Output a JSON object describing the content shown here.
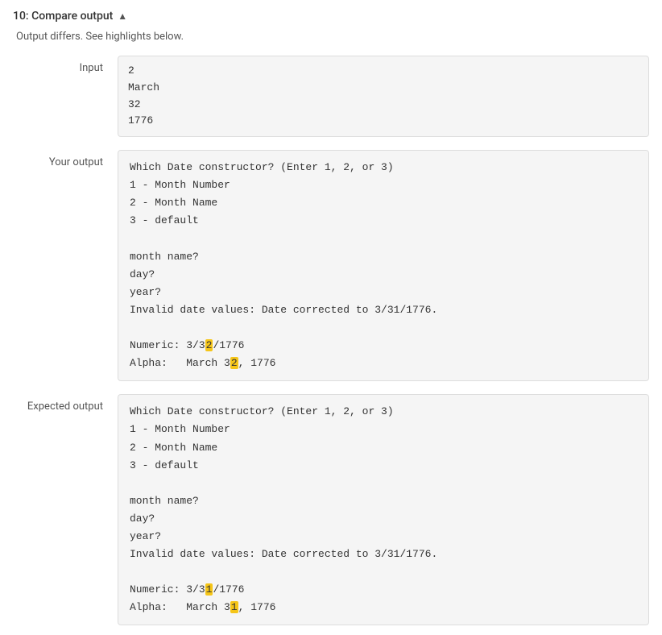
{
  "header": {
    "title": "10: Compare output",
    "chevron": "▲"
  },
  "diff_notice": "Output differs. See highlights below.",
  "input": {
    "label": "Input",
    "lines": [
      "2",
      "March",
      "32",
      "1776"
    ]
  },
  "your_output": {
    "label": "Your output",
    "line1": "Which Date constructor? (Enter 1, 2, or 3)",
    "line2": "1 - Month Number",
    "line3": "2 - Month Name",
    "line4": "3 - default",
    "line5": "",
    "line6": "month name?",
    "line7": "day?",
    "line8": "year?",
    "line9_prefix": "Invalid date values: Date corrected to 3/31/1776.",
    "line10": "",
    "line11_prefix": "Numeric: 3/3",
    "line11_highlight": "2",
    "line11_suffix": "/1776",
    "line12_prefix": "Alpha:   March 3",
    "line12_highlight": "2",
    "line12_suffix": ", 1776"
  },
  "expected_output": {
    "label": "Expected output",
    "line1": "Which Date constructor? (Enter 1, 2, or 3)",
    "line2": "1 - Month Number",
    "line3": "2 - Month Name",
    "line4": "3 - default",
    "line5": "",
    "line6": "month name?",
    "line7": "day?",
    "line8": "year?",
    "line9": "Invalid date values: Date corrected to 3/31/1776.",
    "line10": "",
    "line11_prefix": "Numeric: 3/3",
    "line11_highlight": "1",
    "line11_suffix": "/1776",
    "line12_prefix": "Alpha:   March 3",
    "line12_highlight": "1",
    "line12_suffix": ", 1776"
  }
}
